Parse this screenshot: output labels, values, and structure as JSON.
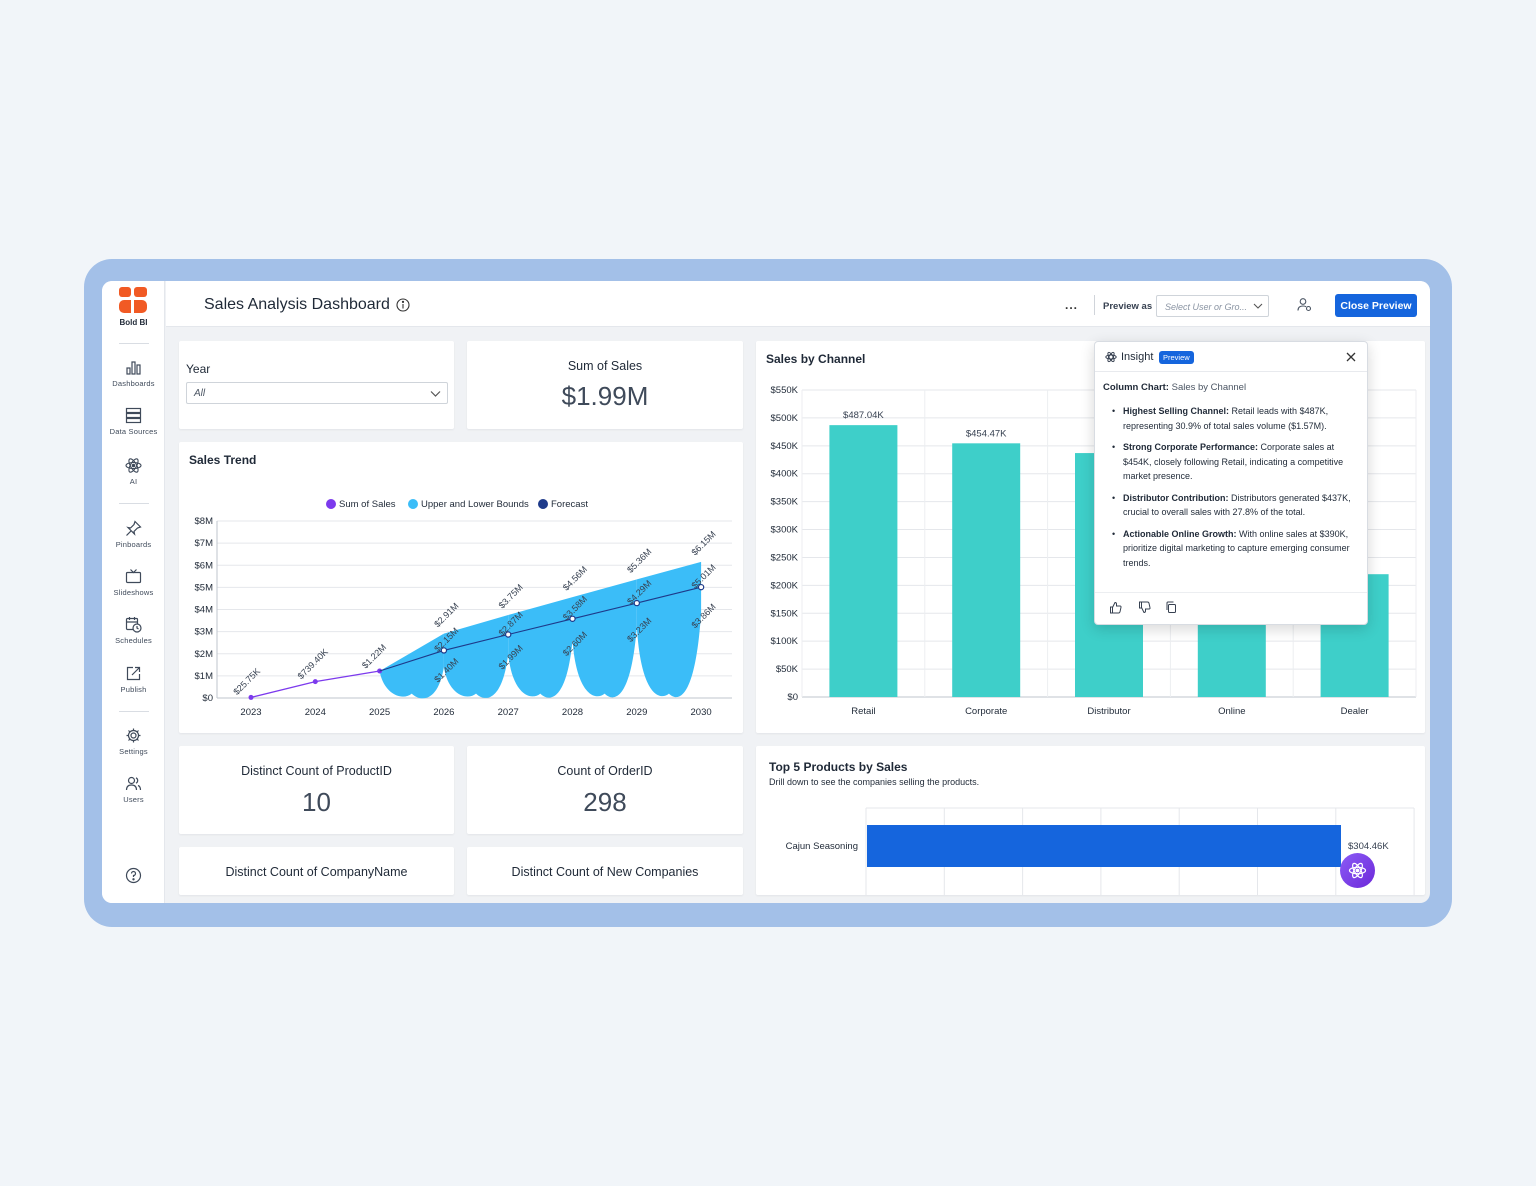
{
  "app": {
    "brand": "Bold BI",
    "title": "Sales Analysis Dashboard"
  },
  "sidebar": {
    "items": [
      {
        "label": "Dashboards",
        "icon": "chart-bar-icon"
      },
      {
        "label": "Data Sources",
        "icon": "database-icon"
      },
      {
        "label": "AI",
        "icon": "atom-icon"
      },
      {
        "label": "Pinboards",
        "icon": "pin-icon"
      },
      {
        "label": "Slideshows",
        "icon": "tv-icon"
      },
      {
        "label": "Schedules",
        "icon": "calendar-clock-icon"
      },
      {
        "label": "Publish",
        "icon": "publish-icon"
      },
      {
        "label": "Settings",
        "icon": "gear-icon"
      },
      {
        "label": "Users",
        "icon": "users-icon"
      }
    ]
  },
  "header": {
    "more_label": "...",
    "preview_as_label": "Preview as",
    "user_select_placeholder": "Select User or Gro...",
    "close_preview_label": "Close Preview"
  },
  "filters": {
    "year_title": "Year",
    "year_value": "All"
  },
  "kpis": {
    "sum_of_sales": {
      "label": "Sum of Sales",
      "value": "$1.99M"
    },
    "distinct_product": {
      "label": "Distinct Count of ProductID",
      "value": "10"
    },
    "count_order": {
      "label": "Count of OrderID",
      "value": "298"
    },
    "distinct_company": {
      "label": "Distinct Count of CompanyName"
    },
    "distinct_new": {
      "label": "Distinct Count of New Companies"
    }
  },
  "colors": {
    "accent": "#1565dd",
    "teal": "#3ecfc9",
    "trend_line": "#7c3aed",
    "bounds": "#3bbdf8",
    "forecast": "#1e3a8a"
  },
  "sales_trend": {
    "title": "Sales Trend",
    "chart_data": {
      "type": "area",
      "categories": [
        "2023",
        "2024",
        "2025",
        "2026",
        "2027",
        "2028",
        "2029",
        "2030"
      ],
      "yticks": [
        "$0",
        "$1M",
        "$2M",
        "$3M",
        "$4M",
        "$5M",
        "$6M",
        "$7M",
        "$8M"
      ],
      "ylim": [
        0,
        8000000
      ],
      "legend": [
        "Sum of Sales",
        "Upper and Lower Bounds",
        "Forecast"
      ],
      "series": [
        {
          "name": "Sum of Sales",
          "x": [
            "2023",
            "2024",
            "2025"
          ],
          "values": [
            25750,
            739400,
            1220000
          ],
          "labels": [
            "$25.75K",
            "$739.40K",
            "$1.22M"
          ]
        },
        {
          "name": "Forecast",
          "x": [
            "2025",
            "2026",
            "2027",
            "2028",
            "2029",
            "2030"
          ],
          "values": [
            1220000,
            2150000,
            2870000,
            3580000,
            4290000,
            5010000
          ],
          "labels": [
            "",
            "$2.15M",
            "$2.87M",
            "$3.58M",
            "$4.29M",
            "$5.01M"
          ]
        },
        {
          "name": "Upper and Lower Bounds",
          "x": [
            "2026",
            "2027",
            "2028",
            "2029",
            "2030"
          ],
          "upper": [
            2910000,
            3750000,
            4560000,
            5360000,
            6150000
          ],
          "lower": [
            1400000,
            1990000,
            2600000,
            3230000,
            3860000
          ],
          "upper_labels": [
            "$2.91M",
            "$3.75M",
            "$4.56M",
            "$5.36M",
            "$6.15M"
          ],
          "lower_labels": [
            "$1.40M",
            "$1.99M",
            "$2.60M",
            "$3.23M",
            "$3.86M"
          ]
        }
      ]
    }
  },
  "sales_by_channel": {
    "title": "Sales by Channel",
    "chart_data": {
      "type": "bar",
      "categories": [
        "Retail",
        "Corporate",
        "Distributor",
        "Online",
        "Dealer"
      ],
      "values": [
        487040,
        454470,
        437000,
        390000,
        220000
      ],
      "labels": [
        "$487.04K",
        "$454.47K",
        "",
        "",
        ""
      ],
      "yticks": [
        "$0",
        "$50K",
        "$100K",
        "$150K",
        "$200K",
        "$250K",
        "$300K",
        "$350K",
        "$400K",
        "$450K",
        "$500K",
        "$550K"
      ],
      "ylim": [
        0,
        550000
      ]
    }
  },
  "top_products": {
    "title": "Top 5 Products by Sales",
    "subtitle": "Drill down to see the companies selling the products.",
    "chart_data": {
      "type": "bar",
      "categories": [
        "Cajun Seasoning"
      ],
      "values": [
        304460
      ],
      "labels": [
        "$304.46K"
      ]
    }
  },
  "insight": {
    "title": "Insight",
    "badge": "Preview",
    "subtitle_bold": "Column Chart:",
    "subtitle_rest": "Sales by Channel",
    "points": [
      {
        "bold": "Highest Selling Channel:",
        "text": "Retail leads with $487K, representing 30.9% of total sales volume ($1.57M)."
      },
      {
        "bold": "Strong Corporate Performance:",
        "text": "Corporate sales at $454K, closely following Retail, indicating a competitive market presence."
      },
      {
        "bold": "Distributor Contribution:",
        "text": "Distributors generated $437K, crucial to overall sales with 27.8% of the total."
      },
      {
        "bold": "Actionable Online Growth:",
        "text": "With online sales at $390K, prioritize digital marketing to capture emerging consumer trends."
      }
    ]
  }
}
